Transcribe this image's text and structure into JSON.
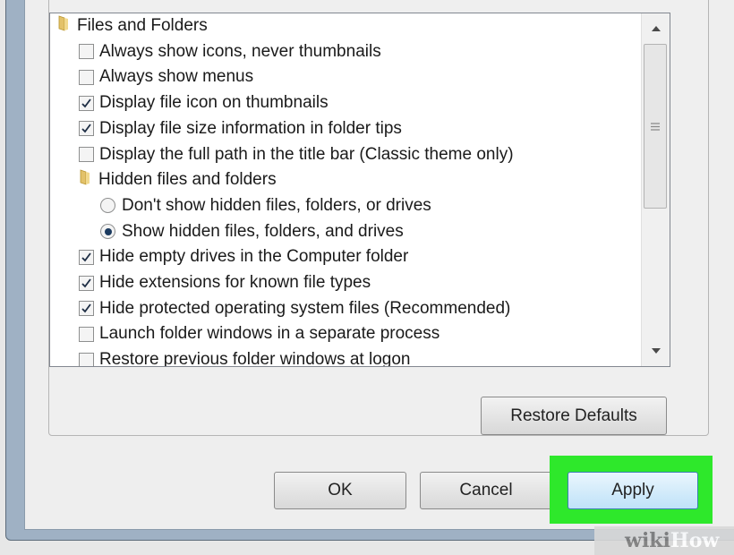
{
  "tree": {
    "items": [
      {
        "type": "folder",
        "label": "Files and Folders",
        "level": 0
      },
      {
        "type": "checkbox",
        "label": "Always show icons, never thumbnails",
        "checked": false,
        "level": 1
      },
      {
        "type": "checkbox",
        "label": "Always show menus",
        "checked": false,
        "level": 1
      },
      {
        "type": "checkbox",
        "label": "Display file icon on thumbnails",
        "checked": true,
        "level": 1
      },
      {
        "type": "checkbox",
        "label": "Display file size information in folder tips",
        "checked": true,
        "level": 1
      },
      {
        "type": "checkbox",
        "label": "Display the full path in the title bar (Classic theme only)",
        "checked": false,
        "level": 1
      },
      {
        "type": "folder",
        "label": "Hidden files and folders",
        "level": 1
      },
      {
        "type": "radio",
        "label": "Don't show hidden files, folders, or drives",
        "checked": false,
        "level": 2
      },
      {
        "type": "radio",
        "label": "Show hidden files, folders, and drives",
        "checked": true,
        "level": 2
      },
      {
        "type": "checkbox",
        "label": "Hide empty drives in the Computer folder",
        "checked": true,
        "level": 1
      },
      {
        "type": "checkbox",
        "label": "Hide extensions for known file types",
        "checked": true,
        "level": 1
      },
      {
        "type": "checkbox",
        "label": "Hide protected operating system files (Recommended)",
        "checked": true,
        "level": 1
      },
      {
        "type": "checkbox",
        "label": "Launch folder windows in a separate process",
        "checked": false,
        "level": 1
      },
      {
        "type": "checkbox",
        "label": "Restore previous folder windows at logon",
        "checked": false,
        "level": 1
      }
    ]
  },
  "buttons": {
    "restore_defaults": "Restore Defaults",
    "ok": "OK",
    "cancel": "Cancel",
    "apply": "Apply"
  },
  "watermark": {
    "wiki": "wiki",
    "how": "How"
  },
  "colors": {
    "highlight": "#2ee82b",
    "apply_border": "#3c7fb1"
  }
}
